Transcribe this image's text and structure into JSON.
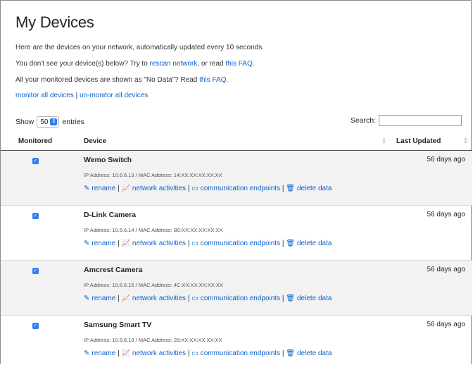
{
  "page": {
    "title": "My Devices",
    "intro": "Here are the devices on your network, automatically updated every 10 seconds.",
    "missing_prefix": "You don't see your device(s) below? Try to",
    "rescan_link": "rescan network",
    "missing_mid": ", or read",
    "faq_link_1": "this FAQ.",
    "nodata_prefix": "All your monitored devices are shown as \"No Data\"? Read",
    "faq_link_2": "this FAQ.",
    "monitor_all": "monitor all devices",
    "sep": "|",
    "unmonitor_all": "un-monitor all devices"
  },
  "table_controls": {
    "show_label": "Show",
    "entries_value": "50",
    "entries_label": "entries",
    "search_label": "Search:",
    "search_value": ""
  },
  "table": {
    "headers": {
      "monitored": "Monitored",
      "device": "Device",
      "last_updated": "Last Updated"
    },
    "actions": {
      "rename": "rename",
      "network": "network activities",
      "endpoints": "communication endpoints",
      "delete": "delete data"
    },
    "rows": [
      {
        "name": "Wemo Switch",
        "address": "IP Address: 10.6.6.13 / MAC Address: 14:XX:XX:XX:XX:XX",
        "updated": "56 days ago",
        "monitored": true
      },
      {
        "name": "D-Link Camera",
        "address": "IP Address: 10.6.6.14 / MAC Address: B0:XX:XX:XX:XX:XX",
        "updated": "56 days ago",
        "monitored": true
      },
      {
        "name": "Amcrest Camera",
        "address": "IP Address: 10.6.6.15 / MAC Address: 4C:XX:XX:XX:XX:XX",
        "updated": "56 days ago",
        "monitored": true
      },
      {
        "name": "Samsung Smart TV",
        "address": "IP Address: 10.6.6.19 / MAC Address: 28:XX:XX:XX:XX:XX",
        "updated": "56 days ago",
        "monitored": true
      }
    ]
  },
  "colors": {
    "link": "#0b63ce",
    "checkbox": "#2f7ff0",
    "row_stripe": "#f2f2f2"
  },
  "icons": {
    "rename": "edit-icon",
    "network": "chart-line-icon",
    "endpoints": "monitor-icon",
    "delete": "trash-icon"
  }
}
